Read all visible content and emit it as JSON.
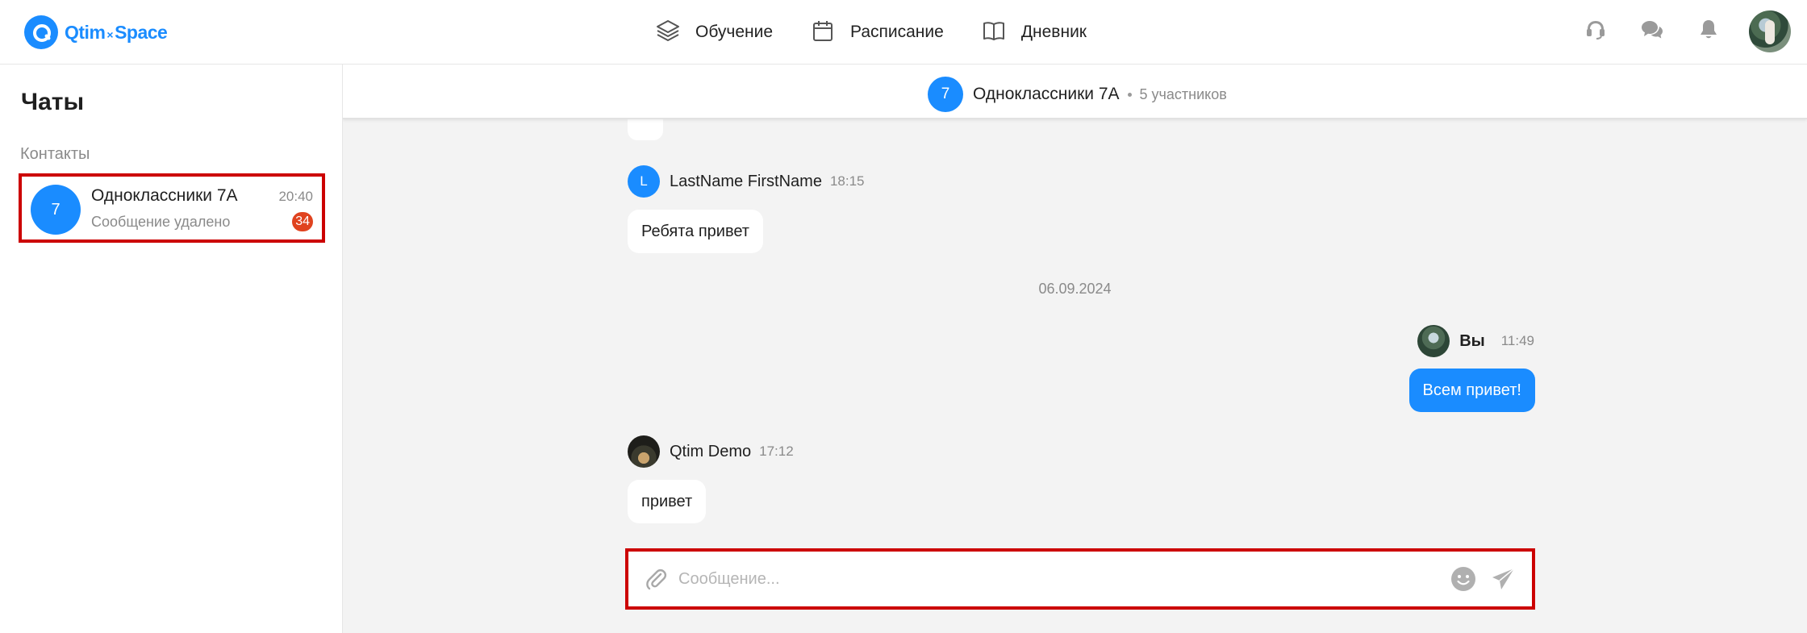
{
  "topbar": {
    "logo": {
      "brand": "Qtim",
      "separator": "×",
      "product": "Space"
    },
    "nav": [
      {
        "label": "Обучение",
        "icon": "layers-icon"
      },
      {
        "label": "Расписание",
        "icon": "calendar-icon"
      },
      {
        "label": "Дневник",
        "icon": "book-icon"
      }
    ],
    "icons": [
      "headset-icon",
      "chat-bubbles-icon",
      "bell-icon"
    ],
    "accent_color": "#1a8cff"
  },
  "sidebar": {
    "title": "Чаты",
    "section_label": "Контакты",
    "chats": [
      {
        "avatar_text": "7",
        "name": "Одноклассники 7А",
        "time": "20:40",
        "preview": "Сообщение удалено",
        "unread": "34"
      }
    ]
  },
  "chat": {
    "header": {
      "avatar_text": "7",
      "name": "Одноклассники 7А",
      "members": "5 участников"
    },
    "messages": [
      {
        "avatar_text": "L",
        "author": "LastName FirstName",
        "time": "18:15",
        "text": "Ребята привет"
      },
      {
        "author": "Вы",
        "time": "11:49",
        "text": "Всем привет!"
      },
      {
        "author": "Qtim Demo",
        "time": "17:12",
        "text": "привет"
      }
    ],
    "date_separator": "06.09.2024",
    "composer": {
      "placeholder": "Сообщение..."
    }
  }
}
